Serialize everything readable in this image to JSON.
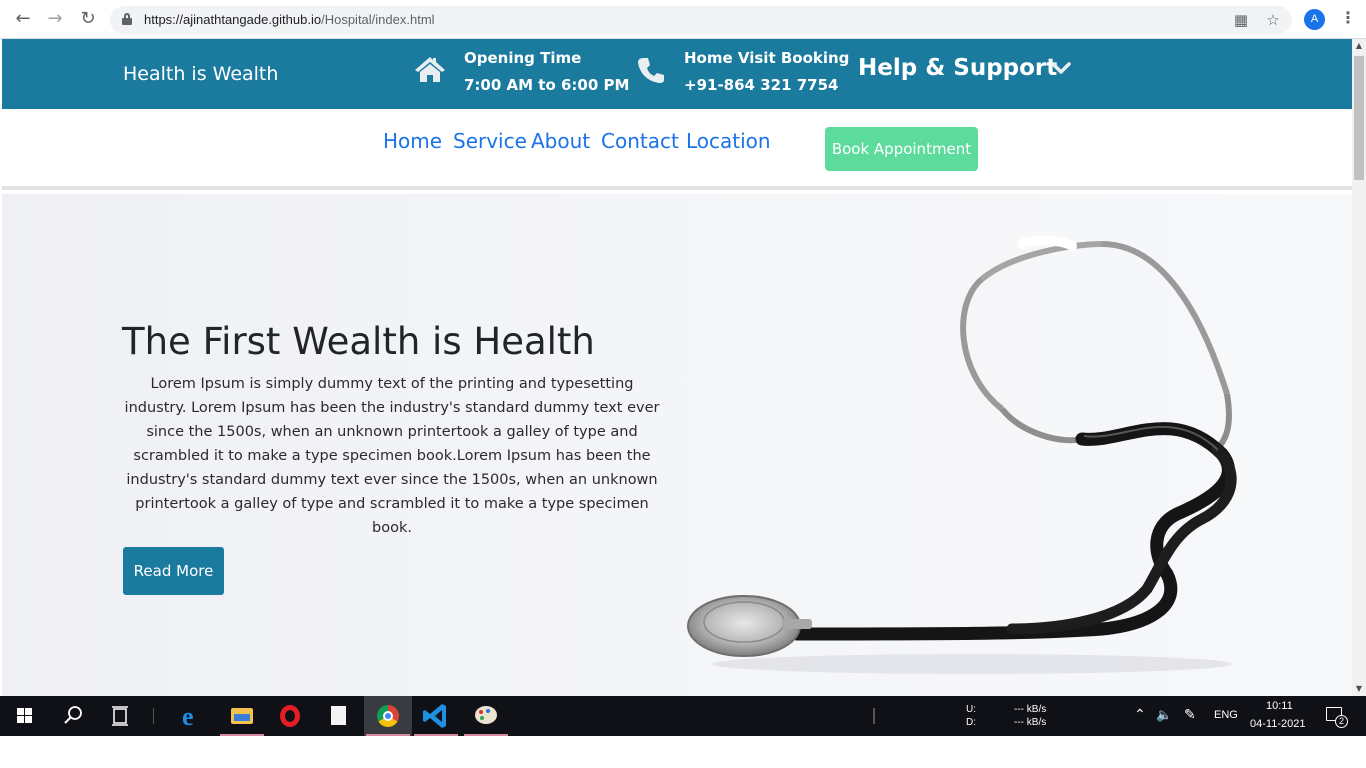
{
  "browser": {
    "url_host": "https://ajinathtangade.github.io",
    "url_path": "/Hospital/index.html",
    "profile_initial": "A"
  },
  "topbar": {
    "brand": "Health is Wealth",
    "opening_title": "Opening Time",
    "opening_value": "7:00 AM to 6:00 PM",
    "booking_title": "Home Visit Booking",
    "booking_value": "+91-864 321 7754",
    "help": "Help & Support"
  },
  "nav": {
    "links": [
      "Home",
      "Service",
      "About",
      "Contact",
      "Location"
    ],
    "book_button": "Book Appointment"
  },
  "hero": {
    "title": "The First Wealth is Health",
    "text": "Lorem Ipsum is simply dummy text of the printing and typesetting industry. Lorem Ipsum has been the industry's standard dummy text ever since the 1500s, when an unknown printertook a galley of type and scrambled it to make a type specimen book.Lorem Ipsum has been the industry's standard dummy text ever since the 1500s, when an unknown printertook a galley of type and scrambled it to make a type specimen book.",
    "button": "Read More"
  },
  "taskbar": {
    "net_upload_label": "U:",
    "net_download_label": "D:",
    "net_upload_value": "--- kB/s",
    "net_download_value": "--- kB/s",
    "language": "ENG",
    "time": "10:11",
    "date": "04-11-2021",
    "notification_count": "2"
  },
  "colors": {
    "brand_blue": "#1a7b9f",
    "link_blue": "#1a73e8",
    "book_green": "#5ddb9c"
  }
}
